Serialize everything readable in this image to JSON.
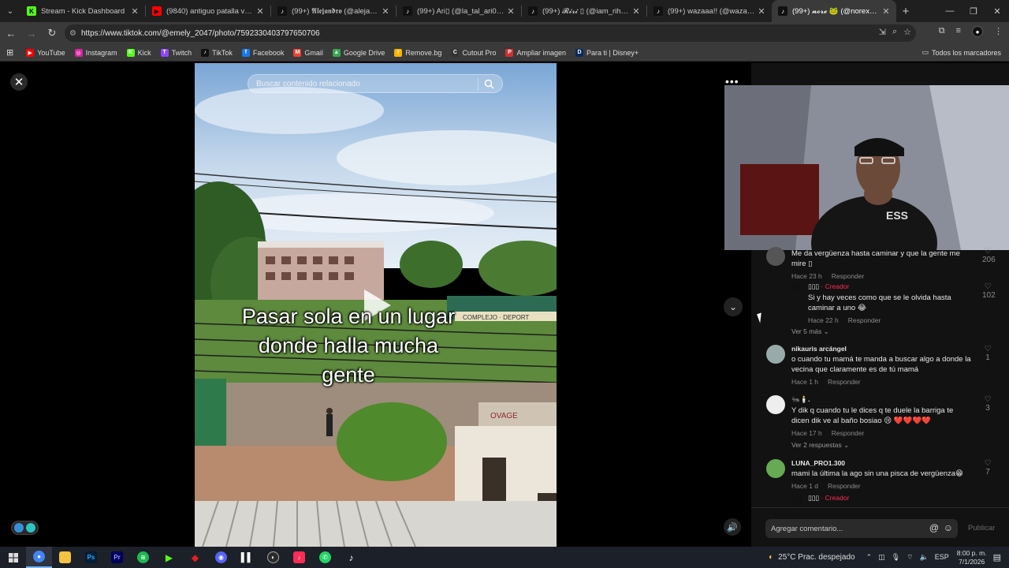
{
  "browser": {
    "tabs": [
      {
        "title": "Stream - Kick Dashboard",
        "icon": "kick-icon",
        "color": "#53fc18",
        "active": false
      },
      {
        "title": "(9840) antiguo patalla verde - Y",
        "icon": "youtube-icon",
        "color": "#ff0000",
        "active": false
      },
      {
        "title": "(99+) 𝕬𝖑𝖊𝖏𝖆𝖓𝖉𝖗𝖔 (@alejandr10vi",
        "icon": "tiktok-icon",
        "color": "#111111",
        "active": false
      },
      {
        "title": "(99+) Ari▯ (@la_tal_ari0) | TikTok",
        "icon": "tiktok-icon",
        "color": "#111111",
        "active": false
      },
      {
        "title": "(99+) 𝓡𝓲𝓻𝓲 ▯ (@iam_rihanna13",
        "icon": "tiktok-icon",
        "color": "#111111",
        "active": false
      },
      {
        "title": "(99+) wazaaa!! (@wazaaa9173)",
        "icon": "tiktok-icon",
        "color": "#111111",
        "active": false
      },
      {
        "title": "(99+) 𝓷𝓸𝓻𝓮 🐸 (@norexxh2) | T",
        "icon": "tiktok-icon",
        "color": "#111111",
        "active": true
      }
    ],
    "url": "https://www.tiktok.com/@emely_2047/photo/7592330403797650706",
    "bookmarks": [
      {
        "label": "YouTube",
        "color": "#ff0000",
        "glyph": "▶"
      },
      {
        "label": "Instagram",
        "color": "#d6249f",
        "glyph": "◎"
      },
      {
        "label": "Kick",
        "color": "#53fc18",
        "glyph": "K"
      },
      {
        "label": "Twitch",
        "color": "#9146ff",
        "glyph": "T"
      },
      {
        "label": "TikTok",
        "color": "#111111",
        "glyph": "♪"
      },
      {
        "label": "Facebook",
        "color": "#1877f2",
        "glyph": "f"
      },
      {
        "label": "Gmail",
        "color": "#ea4335",
        "glyph": "M"
      },
      {
        "label": "Google Drive",
        "color": "#34a853",
        "glyph": "▲"
      },
      {
        "label": "Remove.bg",
        "color": "#f7b500",
        "glyph": "r"
      },
      {
        "label": "Cutout Pro",
        "color": "#333333",
        "glyph": "C"
      },
      {
        "label": "Ampliar imagen",
        "color": "#d32f2f",
        "glyph": "P"
      },
      {
        "label": "Para ti | Disney+",
        "color": "#0a2a5e",
        "glyph": "D"
      }
    ],
    "all_bookmarks": "Todos los marcadores"
  },
  "video": {
    "search_placeholder": "Buscar contenido relacionado",
    "caption_line1": "Pasar sola en un lugar",
    "caption_line2": "donde halla mucha",
    "caption_line3": "gente",
    "wall_text": "COMPLEJO · DEPORT",
    "wall_text2": "OVAGE"
  },
  "comments": [
    {
      "user": "",
      "creator": false,
      "text": "Me da vergüenza hasta caminar y que la gente me mire ▯",
      "time": "Hace 23 h",
      "reply": "Responder",
      "likes": "206"
    },
    {
      "user": "▯▯▯",
      "creator": true,
      "creator_label": "· Creador",
      "text": "Si y hay veces como que se le olvida hasta caminar a uno 😂",
      "time": "Hace 22 h",
      "reply": "Responder",
      "likes": "102"
    },
    {
      "user": "nikauris arcángel",
      "creator": false,
      "text": "o cuando tu mamá te manda a buscar algo a donde la vecina que claramente es de tú mamá",
      "time": "Hace 1 h",
      "reply": "Responder",
      "likes": "1"
    },
    {
      "user": "🐜🕯️.",
      "creator": false,
      "text": "Y dik q cuando tu le dices q te duele la barriga te dicen dik ve al baño bosiao 😢 ❤️❤️❤️❤️",
      "time": "Hace 17 h",
      "reply": "Responder",
      "likes": "3"
    },
    {
      "user": "LUNA_PRO1.300",
      "creator": false,
      "text": "mami la última la ago sin una pisca de vergüenza😁",
      "time": "Hace 1 d",
      "reply": "Responder",
      "likes": "7"
    },
    {
      "user": "▯▯▯",
      "creator": true,
      "creator_label": "· Creador",
      "text": "",
      "time": "",
      "reply": "",
      "likes": ""
    }
  ],
  "see_more_1": "Ver 5 más ⌄",
  "see_more_2": "Ver 2 respuestas ⌄",
  "comment_input": {
    "placeholder": "Agregar comentario...",
    "publish": "Publicar"
  },
  "taskbar": {
    "weather": "25°C  Prac. despejado",
    "lang": "ESP",
    "time": "8:00 p. m.",
    "date": "7/1/2026"
  }
}
